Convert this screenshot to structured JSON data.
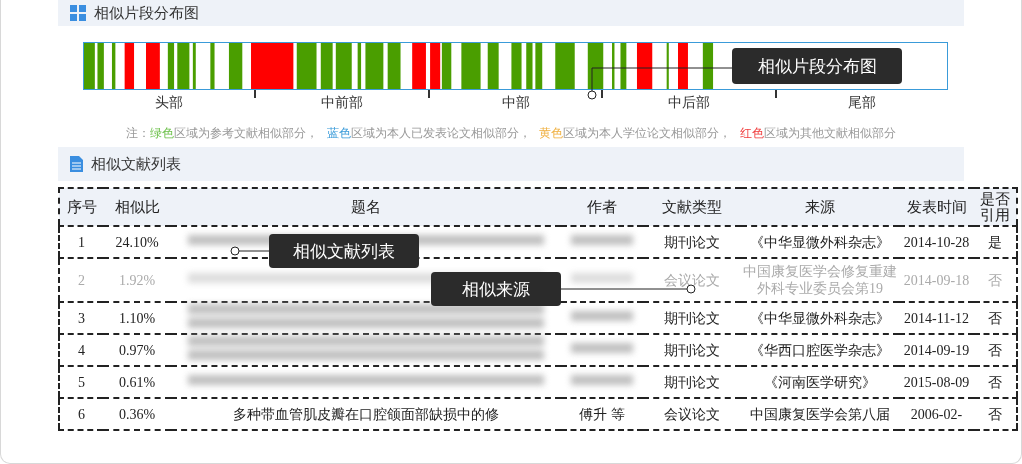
{
  "distribution": {
    "title": "相似片段分布图",
    "sections": [
      "头部",
      "中前部",
      "中部",
      "中后部",
      "尾部"
    ],
    "legend": [
      {
        "prefix": "注：",
        "word": "绿色",
        "rest": "区域为参考文献相似部分，",
        "color": "#6cc04a"
      },
      {
        "word": "蓝色",
        "rest": "区域为本人已发表论文相似部分，",
        "color": "#3a9bd9"
      },
      {
        "word": "黄色",
        "rest": "区域为本人学位论文相似部分，",
        "color": "#f0b040"
      },
      {
        "word": "红色",
        "rest": "区域为其他文献相似部分",
        "color": "#f03c3c"
      }
    ]
  },
  "literature": {
    "title": "相似文献列表",
    "columns": [
      "序号",
      "相似比",
      "题名",
      "作者",
      "文献类型",
      "来源",
      "发表时间",
      "是否引用"
    ],
    "rows": [
      {
        "index": "1",
        "ratio": "24.10%",
        "title_blurred": true,
        "author_blurred": true,
        "type": "期刊论文",
        "source": "《中华显微外科杂志》",
        "date": "2014-10-28",
        "cited": "是",
        "dimmed": false
      },
      {
        "index": "2",
        "ratio": "1.92%",
        "title_blurred": true,
        "author_blurred": true,
        "type": "会议论文",
        "source": "中国康复医学会修复重建外科专业委员会第19",
        "date": "2014-09-18",
        "cited": "否",
        "dimmed": true
      },
      {
        "index": "3",
        "ratio": "1.10%",
        "title_blurred": true,
        "author_blurred": true,
        "type": "期刊论文",
        "source": "《中华显微外科杂志》",
        "date": "2014-11-12",
        "cited": "否",
        "dimmed": false
      },
      {
        "index": "4",
        "ratio": "0.97%",
        "title_blurred": true,
        "author_blurred": true,
        "type": "期刊论文",
        "source": "《华西口腔医学杂志》",
        "date": "2014-09-19",
        "cited": "否",
        "dimmed": false
      },
      {
        "index": "5",
        "ratio": "0.61%",
        "title_blurred": true,
        "author_blurred": true,
        "type": "期刊论文",
        "source": "《河南医学研究》",
        "date": "2015-08-09",
        "cited": "否",
        "dimmed": false
      },
      {
        "index": "6",
        "ratio": "0.36%",
        "title": "多种带血管肌皮瓣在口腔颌面部缺损中的修",
        "author": "傅升 等",
        "title_blurred": false,
        "author_blurred": false,
        "type": "会议论文",
        "source": "中国康复医学会第八届",
        "date": "2006-02-",
        "cited": "否",
        "dimmed": false
      }
    ]
  },
  "annotations": [
    "相似片段分布图",
    "相似文献列表",
    "相似来源"
  ]
}
